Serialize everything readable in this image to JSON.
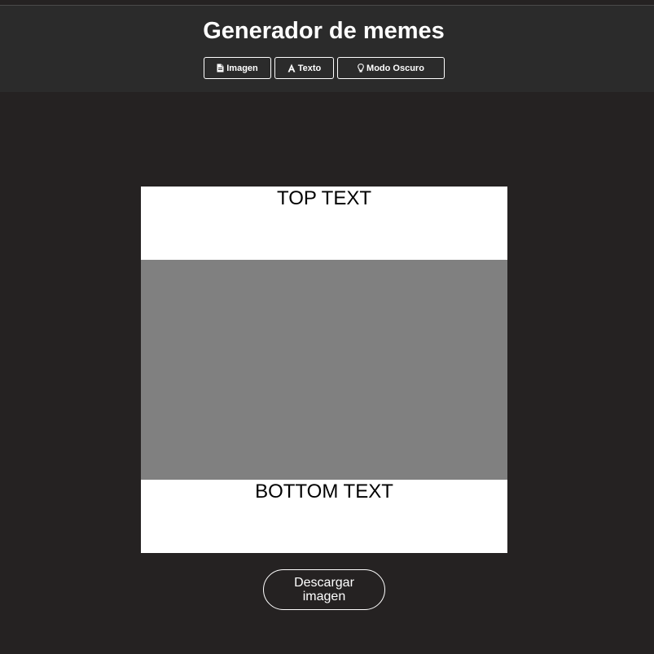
{
  "header": {
    "title": "Generador de memes",
    "buttons": {
      "imagen": "Imagen",
      "texto": "Texto",
      "modo": "Modo Oscuro"
    },
    "icons": {
      "imagen": "file-image-icon",
      "texto": "font-icon",
      "modo": "lightbulb-icon"
    }
  },
  "meme": {
    "top_text": "TOP TEXT",
    "bottom_text": "BOTTOM TEXT",
    "image_color": "#808080",
    "text_bg_color": "#ffffff"
  },
  "download_label": "Descargar imagen",
  "colors": {
    "background": "#252222",
    "header_background": "#2b2b2b",
    "foreground": "#ffffff"
  }
}
